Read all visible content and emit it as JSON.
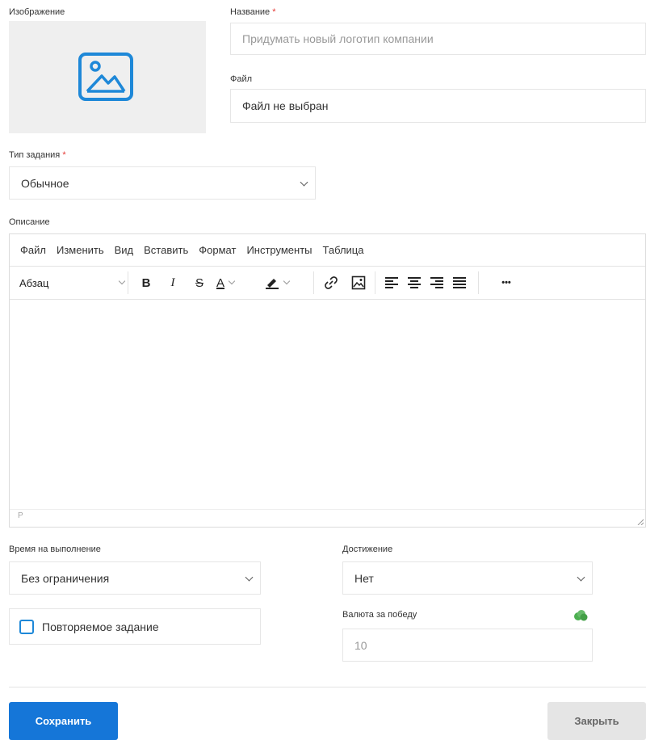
{
  "image_section": {
    "label": "Изображение",
    "placeholder_icon": "image-placeholder-icon"
  },
  "name_field": {
    "label": "Название",
    "required_mark": "*",
    "placeholder": "Придумать новый логотип компании"
  },
  "file_field": {
    "label": "Файл",
    "value": "Файл не выбран"
  },
  "task_type": {
    "label": "Тип задания",
    "required_mark": "*",
    "value": "Обычное"
  },
  "description": {
    "label": "Описание",
    "menu": [
      "Файл",
      "Изменить",
      "Вид",
      "Вставить",
      "Формат",
      "Инструменты",
      "Таблица"
    ],
    "toolbar": {
      "block_format": "Абзац",
      "bold": "B",
      "italic": "I",
      "strike": "S",
      "text_color": "A",
      "more": "•••"
    },
    "status_path": "P"
  },
  "time_limit": {
    "label": "Время на выполнение",
    "value": "Без ограничения"
  },
  "achievement": {
    "label": "Достижение",
    "value": "Нет"
  },
  "repeat_task": {
    "label": "Повторяемое задание",
    "checked": false
  },
  "currency": {
    "label": "Валюта за победу",
    "placeholder": "10",
    "icon": "cloud-coin-icon"
  },
  "actions": {
    "save": "Сохранить",
    "close": "Закрыть"
  },
  "colors": {
    "accent": "#1576d8",
    "checkbox": "#1e88d8",
    "required": "#e53935",
    "coin": "#4caf50"
  }
}
